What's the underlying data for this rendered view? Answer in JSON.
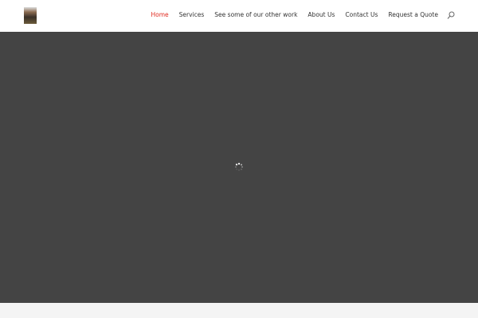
{
  "nav": {
    "items": [
      {
        "label": "Home",
        "active": true
      },
      {
        "label": "Services"
      },
      {
        "label": "See some of our other work"
      },
      {
        "label": "About Us"
      },
      {
        "label": "Contact Us"
      },
      {
        "label": "Request a Quote"
      }
    ]
  },
  "colors": {
    "active": "#e02b20",
    "hero": "#444444"
  }
}
